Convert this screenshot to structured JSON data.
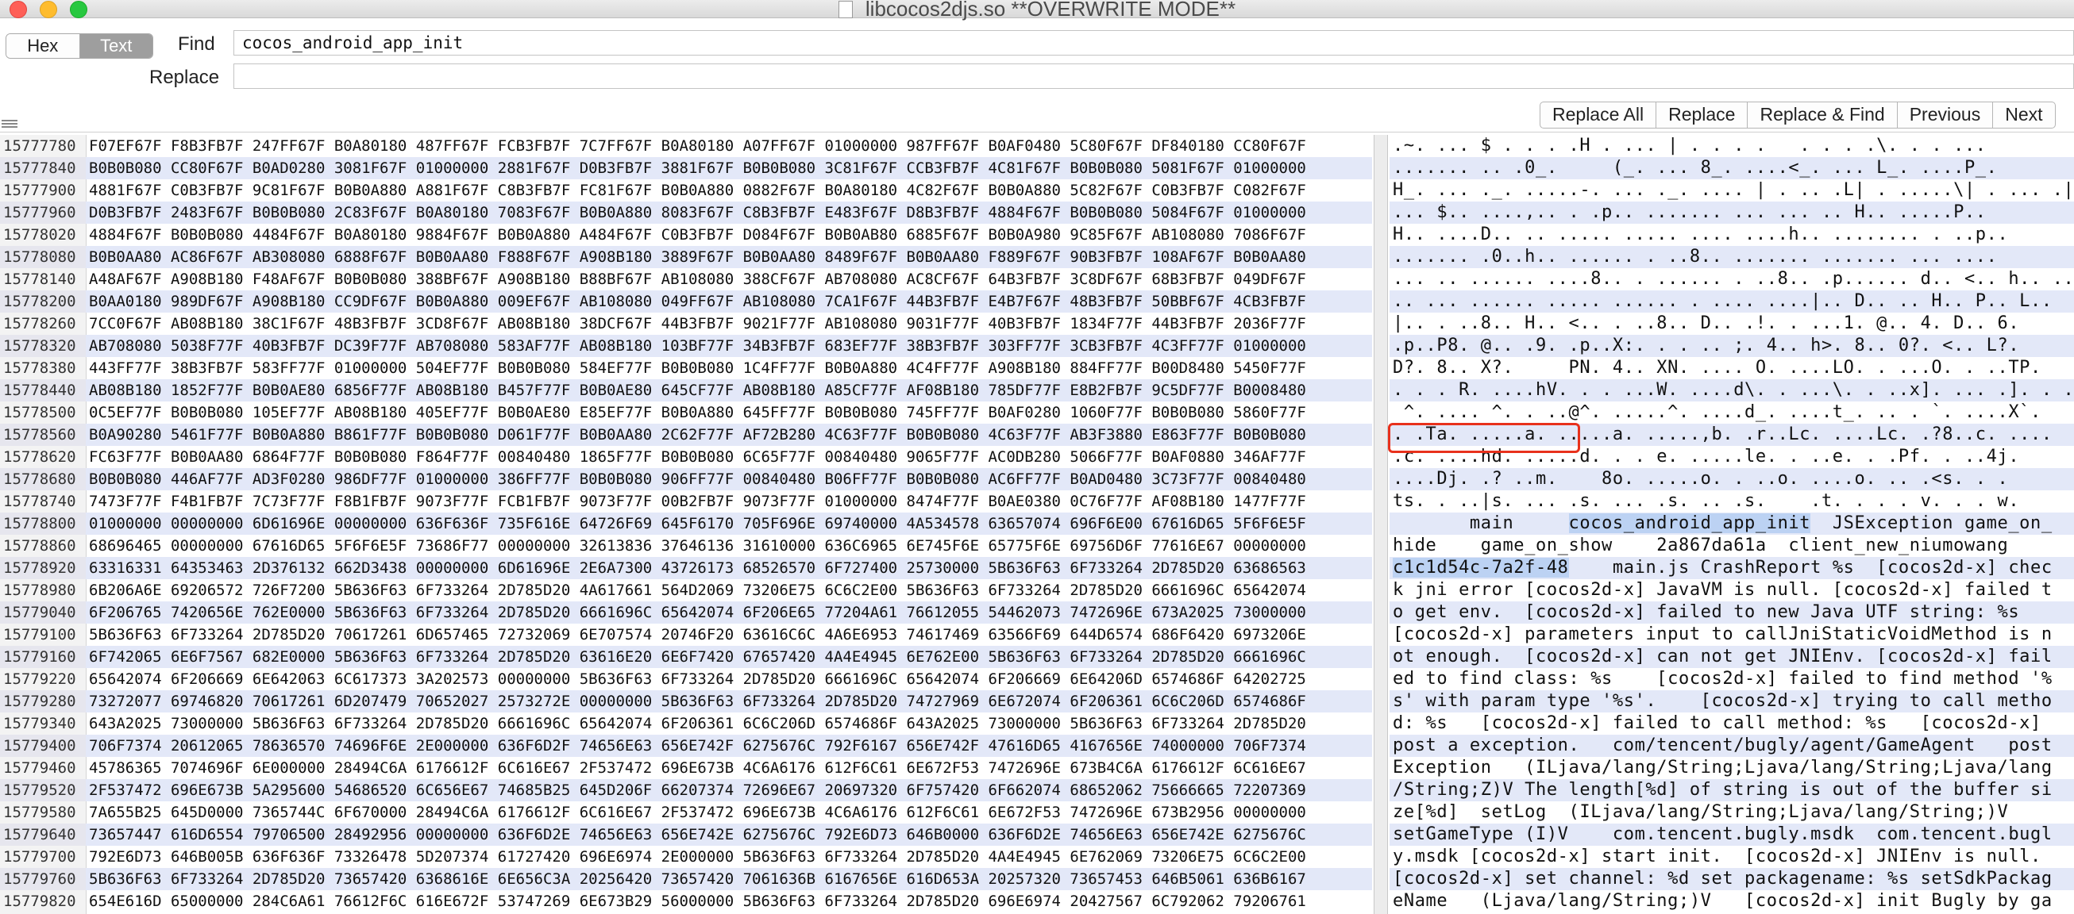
{
  "window": {
    "title": "libcocos2djs.so **OVERWRITE MODE**"
  },
  "mode_toggle": {
    "hex_label": "Hex",
    "text_label": "Text",
    "selected": "Text"
  },
  "find": {
    "label": "Find",
    "value": "cocos_android_app_init"
  },
  "replace": {
    "label": "Replace",
    "value": ""
  },
  "buttons": {
    "replace_all": "Replace All",
    "replace": "Replace",
    "replace_find": "Replace & Find",
    "previous": "Previous",
    "next": "Next"
  },
  "offsets": [
    "15777780",
    "15777840",
    "15777900",
    "15777960",
    "15778020",
    "15778080",
    "15778140",
    "15778200",
    "15778260",
    "15778320",
    "15778380",
    "15778440",
    "15778500",
    "15778560",
    "15778620",
    "15778680",
    "15778740",
    "15778800",
    "15778860",
    "15778920",
    "15778980",
    "15779040",
    "15779100",
    "15779160",
    "15779220",
    "15779280",
    "15779340",
    "15779400",
    "15779460",
    "15779520",
    "15779580",
    "15779640",
    "15779700",
    "15779760",
    "15779820"
  ],
  "hex_rows": [
    "F07EF67F F8B3FB7F 247FF67F B0A80180 487FF67F FCB3FB7F 7C7FF67F B0A80180 A07FF67F 01000000 987FF67F B0AF0480 5C80F67F DF840180 CC80F67F",
    "B0B0B080 CC80F67F B0AD0280 3081F67F 01000000 2881F67F D0B3FB7F 3881F67F B0B0B080 3C81F67F CCB3FB7F 4C81F67F B0B0B080 5081F67F 01000000",
    "4881F67F C0B3FB7F 9C81F67F B0B0A880 A881F67F C8B3FB7F FC81F67F B0B0A880 0882F67F B0A80180 4C82F67F B0B0A880 5C82F67F C0B3FB7F C082F67F",
    "D0B3FB7F 2483F67F B0B0B080 2C83F67F B0A80180 7083F67F B0B0A880 8083F67F C8B3FB7F E483F67F D8B3FB7F 4884F67F B0B0B080 5084F67F 01000000",
    "4884F67F B0B0B080 4484F67F B0A80180 9884F67F B0B0A880 A484F67F C0B3FB7F D084F67F B0B0AB80 6885F67F B0B0A980 9C85F67F AB108080 7086F67F",
    "B0B0AA80 AC86F67F AB308080 6888F67F B0B0AA80 F888F67F A908B180 3889F67F B0B0AA80 8489F67F B0B0AA80 F889F67F 90B3FB7F 108AF67F B0B0AA80",
    "A48AF67F A908B180 F48AF67F B0B0B080 388BF67F A908B180 B88BF67F AB108080 388CF67F AB708080 AC8CF67F 64B3FB7F 3C8DF67F 68B3FB7F 049DF67F",
    "B0AA0180 989DF67F A908B180 CC9DF67F B0B0A880 009EF67F AB108080 049FF67F AB108080 7CA1F67F 44B3FB7F E4B7F67F 48B3FB7F 50BBF67F 4CB3FB7F",
    "7CC0F67F AB08B180 38C1F67F 48B3FB7F 3CD8F67F AB08B180 38DCF67F 44B3FB7F 9021F77F AB108080 9031F77F 40B3FB7F 1834F77F 44B3FB7F 2036F77F",
    "AB708080 5038F77F 40B3FB7F DC39F77F AB708080 583AF77F AB08B180 103BF77F 34B3FB7F 683EF77F 38B3FB7F 303FF77F 3CB3FB7F 4C3FF77F 01000000",
    "443FF77F 38B3FB7F 583FF77F 01000000 504EF77F B0B0B080 584EF77F B0B0B080 1C4FF77F B0B0A880 4C4FF77F A908B180 884FF77F B00D8480 5450F77F",
    "AB08B180 1852F77F B0B0AE80 6856F77F AB08B180 B457F77F B0B0AE80 645CF77F AB08B180 A85CF77F AF08B180 785DF77F E8B2FB7F 9C5DF77F B0008480",
    "0C5EF77F B0B0B080 105EF77F AB08B180 405EF77F B0B0AE80 E85EF77F B0B0A880 645FF77F B0B0B080 745FF77F B0AF0280 1060F77F B0B0B080 5860F77F",
    "B0A90280 5461F77F B0B0A880 B861F77F B0B0B080 D061F77F B0B0AA80 2C62F77F AF72B280 4C63F77F B0B0B080 4C63F77F AB3F3880 E863F77F B0B0B080",
    "FC63F77F B0B0AA80 6864F77F B0B0B080 F864F77F 00840480 1865F77F B0B0B080 6C65F77F 00840480 9065F77F AC0DB280 5066F77F B0AF0880 346AF77F",
    "B0B0B080 446AF77F AD3F0280 986DF77F 01000000 386FF77F B0B0B080 906FF77F 00840480 B06FF77F B0B0B080 AC6FF77F B0AD0480 3C73F77F 00840480",
    "7473F77F F4B1FB7F 7C73F77F F8B1FB7F 9073F77F FCB1FB7F 9073F77F 00B2FB7F 9073F77F 01000000 8474F77F B0AE0380 0C76F77F AF08B180 1477F77F",
    "01000000 00000000 6D61696E 00000000 636F636F 735F616E 64726F69 645F6170 705F696E 69740000 4A534578 63657074 696F6E00 67616D65 5F6F6E5F",
    "68696465 00000000 67616D65 5F6F6E5F 73686F77 00000000 32613836 37646136 31610000 636C6965 6E745F6E 65775F6E 69756D6F 77616E67 00000000",
    "63316331 64353463 2D376132 662D3438 00000000 6D61696E 2E6A7300 43726173 68526570 6F727400 25730000 5B636F63 6F733264 2D785D20 63686563",
    "6B206A6E 69206572 726F7200 5B636F63 6F733264 2D785D20 4A617661 564D2069 73206E75 6C6C2E00 5B636F63 6F733264 2D785D20 6661696C 65642074",
    "6F206765 7420656E 762E0000 5B636F63 6F733264 2D785D20 6661696C 65642074 6F206E65 77204A61 76612055 54462073 7472696E 673A2025 73000000",
    "5B636F63 6F733264 2D785D20 70617261 6D657465 72732069 6E707574 20746F20 63616C6C 4A6E6953 74617469 63566F69 644D6574 686F6420 6973206E",
    "6F742065 6E6F7567 682E0000 5B636F63 6F733264 2D785D20 63616E20 6E6F7420 67657420 4A4E4945 6E762E00 5B636F63 6F733264 2D785D20 6661696C",
    "65642074 6F206669 6E642063 6C617373 3A202573 00000000 5B636F63 6F733264 2D785D20 6661696C 65642074 6F206669 6E64206D 6574686F 64202725",
    "73272077 69746820 70617261 6D207479 70652027 2573272E 00000000 5B636F63 6F733264 2D785D20 74727969 6E672074 6F206361 6C6C206D 6574686F",
    "643A2025 73000000 5B636F63 6F733264 2D785D20 6661696C 65642074 6F206361 6C6C206D 6574686F 643A2025 73000000 5B636F63 6F733264 2D785D20",
    "706F7374 20612065 78636570 74696F6E 2E000000 636F6D2F 74656E63 656E742F 6275676C 792F6167 656E742F 47616D65 4167656E 74000000 706F7374",
    "45786365 7074696F 6E000000 28494C6A 6176612F 6C616E67 2F537472 696E673B 4C6A6176 612F6C61 6E672F53 7472696E 673B4C6A 6176612F 6C616E67",
    "2F537472 696E673B 5A295600 54686520 6C656E67 74685B25 645D206F 66207374 72696E67 20697320 6F757420 6F662074 68652062 75666665 72207369",
    "7A655B25 645D0000 7365744C 6F670000 28494C6A 6176612F 6C616E67 2F537472 696E673B 4C6A6176 612F6C61 6E672F53 7472696E 673B2956 00000000",
    "73657447 616D6554 79706500 28492956 00000000 636F6D2E 74656E63 656E742E 6275676C 792E6D73 646B0000 636F6D2E 74656E63 656E742E 6275676C",
    "792E6D73 646B005B 636F636F 73326478 5D207374 61727420 696E6974 2E000000 5B636F63 6F733264 2D785D20 4A4E4945 6E762069 73206E75 6C6C2E00",
    "5B636F63 6F733264 2D785D20 73657420 6368616E 6E656C3A 20256420 73657420 7061636B 6167656E 616D653A 20257320 73657453 646B5061 636B6167",
    "654E616D 65000000 284C6A61 76612F6C 616E672F 53747269 6E673B29 56000000 5B636F63 6F733264 2D785D20 696E6974 20427567 6C792062 79206761"
  ],
  "text_rows": [
    ".~. ... $ . . . .H . ... | . . . .   . . . .\\. . . ...",
    "....... .. .0_.     (_. ... 8_. ....<_. ... L_. ....P_.",
    "H_. ... ._. .....-. ... ._. .... | . .. .L| . .....\\| . ... .|.",
    "... $.. ....,.. . .p.. ....... ... ... .. H.. .....P..",
    "H.. ....D.. .. ..... ..... .... ....h.. ........ . ..p..",
    "....... .0..h.. ...... . ..8.. ....... ....... ... ....",
    "... .. ...... ....8.. . ...... . ..8.. .p...... d.. <.. h.. ..",
    ".. ... ...... ..... ...... . .... ....|.. D.. .. H.. P.. L..",
    "|.. . ..8.. H.. <.. . ..8.. D.. .!. . ...1. @.. 4. D.. 6.",
    ".p..P8. @.. .9. .p..X:. . . .. ;. 4.. h>. 8.. 0?. <.. L?.",
    "D?. 8.. X?.     PN. 4.. XN. .... O. ....LO. . ...O. . ..TP.",
    ". . . R. ....hV. . . ...W. ....d\\. . ...\\. . ..x]. ... .]. . ..",
    " ^. .... ^. . ..@^. .....^. ....d_. ....t_. .. . `. ....X`.",
    ". .Ta. .....a. .....a. .....,b. .r..Lc. ....Lc. .?8..c. ....",
    ".c. ....hd. .....d. . . e. .....le. . ..e. . .Pf. . ..4j.",
    "....Dj. .? ..m.    8o. .....o. . ..o. ....o. .. .<s. . .",
    "ts. . ..|s. ... .s. ... .s. .. .s.    .t. . . . v. . . w.",
    "       main     cocos_android_app_init  JSException game_on_",
    "hide    game_on_show    2a867da61a  client_new_niumowang",
    "c1c1d54c-7a2f-48    main.js CrashReport %s  [cocos2d-x] chec",
    "k jni error [cocos2d-x] JavaVM is null. [cocos2d-x] failed t",
    "o get env.  [cocos2d-x] failed to new Java UTF string: %s",
    "[cocos2d-x] parameters input to callJniStaticVoidMethod is n",
    "ot enough.  [cocos2d-x] can not get JNIEnv. [cocos2d-x] fail",
    "ed to find class: %s    [cocos2d-x] failed to find method '%",
    "s' with param type '%s'.    [cocos2d-x] trying to call metho",
    "d: %s   [cocos2d-x] failed to call method: %s   [cocos2d-x]",
    "post a exception.   com/tencent/bugly/agent/GameAgent   post",
    "Exception   (ILjava/lang/String;Ljava/lang/String;Ljava/lang",
    "/String;Z)V The length[%d] of string is out of the buffer si",
    "ze[%d]  setLog  (ILjava/lang/String;Ljava/lang/String;)V",
    "setGameType (I)V    com.tencent.bugly.msdk  com.tencent.bugl",
    "y.msdk [cocos2d-x] start init.  [cocos2d-x] JNIEnv is null.",
    "[cocos2d-x] set channel: %d set packagename: %s setSdkPackag",
    "eName   (Ljava/lang/String;)V   [cocos2d-x] init Bugly by ga"
  ],
  "highlight": {
    "match_text": "cocos_android_app_init",
    "boxed_text": "c1c1d54c-7a2f-48",
    "box_color": "#e8311c",
    "selection_color": "#bcd2f3"
  }
}
